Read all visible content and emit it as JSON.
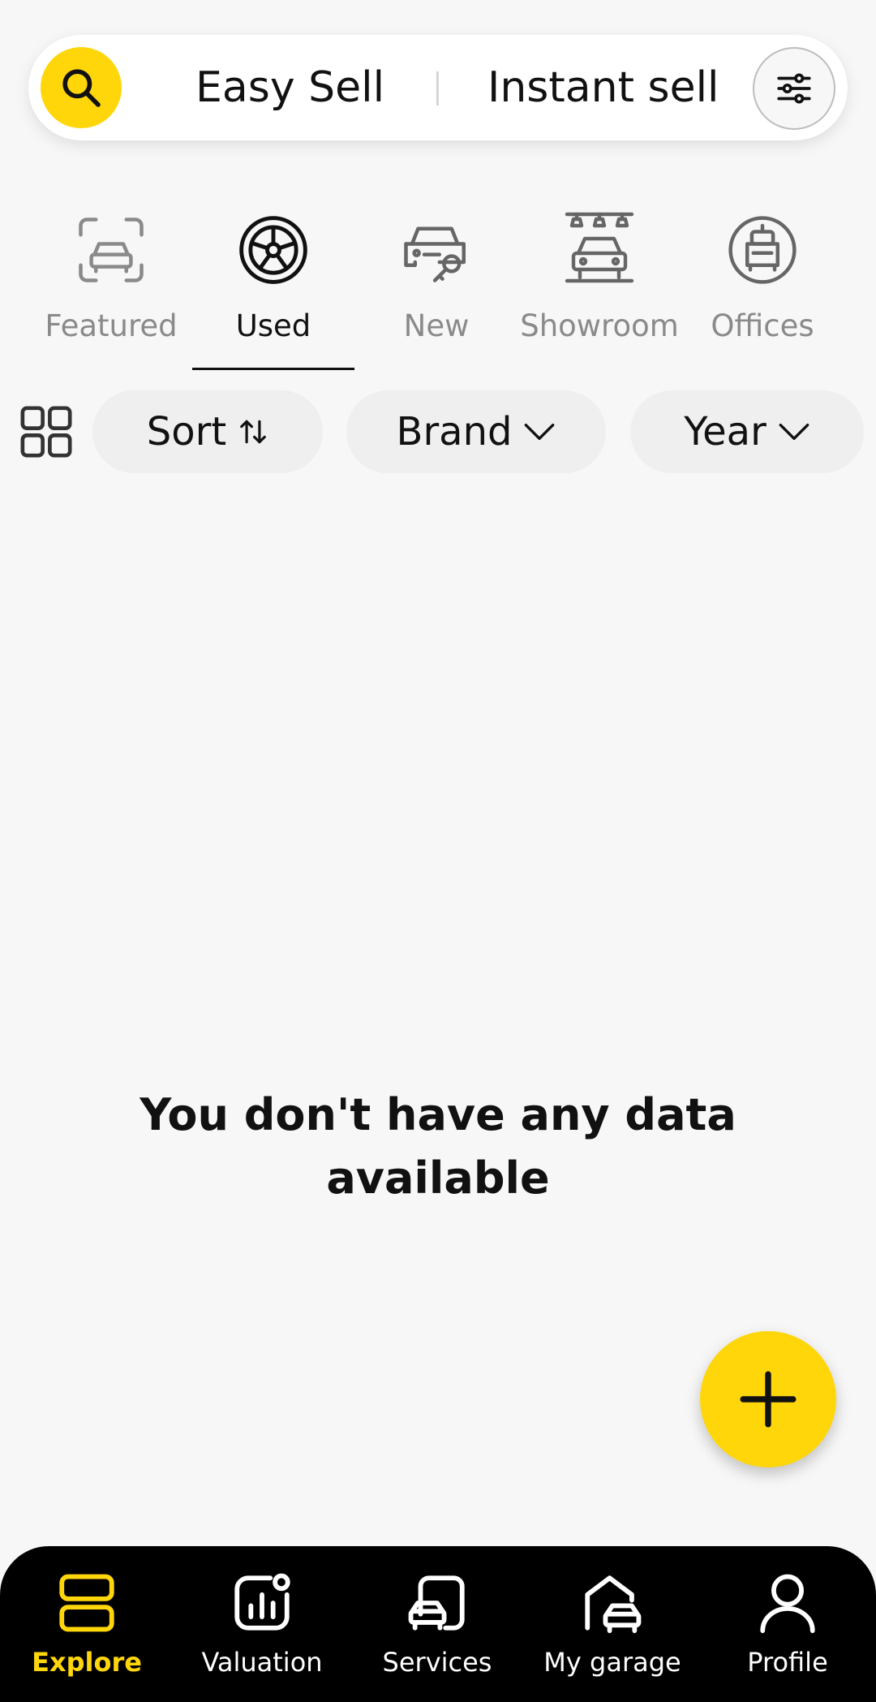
{
  "header": {
    "easy_sell": "Easy Sell",
    "instant_sell": "Instant sell",
    "search_icon": "search-icon",
    "filter_icon": "sliders-icon"
  },
  "categories": [
    {
      "label": "Featured",
      "icon": "car-frame-icon",
      "active": false
    },
    {
      "label": "Used",
      "icon": "wheel-icon",
      "active": true
    },
    {
      "label": "New",
      "icon": "car-key-icon",
      "active": false
    },
    {
      "label": "Showroom",
      "icon": "showroom-icon",
      "active": false
    },
    {
      "label": "Offices",
      "icon": "office-icon",
      "active": false
    }
  ],
  "filters": {
    "sort": "Sort",
    "brand": "Brand",
    "year": "Year"
  },
  "empty_state": {
    "line1": "You don't have any data",
    "line2": "available"
  },
  "bottom_nav": [
    {
      "label": "Explore",
      "icon": "explore-icon",
      "active": true
    },
    {
      "label": "Valuation",
      "icon": "valuation-icon",
      "active": false
    },
    {
      "label": "Services",
      "icon": "services-icon",
      "active": false
    },
    {
      "label": "My garage",
      "icon": "garage-icon",
      "active": false
    },
    {
      "label": "Profile",
      "icon": "profile-icon",
      "active": false
    }
  ],
  "colors": {
    "accent": "#FFD60A",
    "background": "#F7F7F7",
    "nav_background": "#000000",
    "inactive_text": "#8A8A8A"
  }
}
